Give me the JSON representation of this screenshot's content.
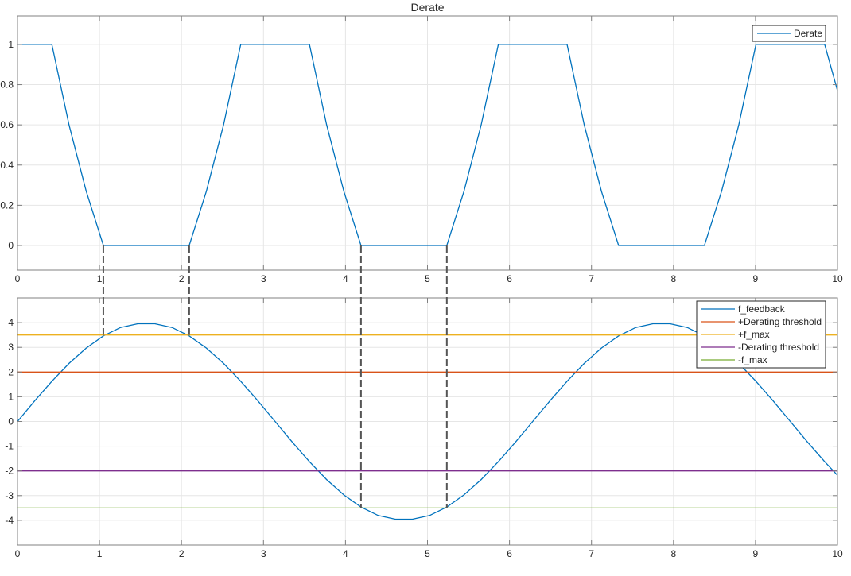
{
  "chart_data": [
    {
      "type": "line",
      "title": "Derate",
      "xlabel": "",
      "ylabel": "",
      "xlim": [
        0,
        10
      ],
      "ylim": [
        -0.1225,
        1.142
      ],
      "xticks": [
        0,
        1,
        2,
        3,
        4,
        5,
        6,
        7,
        8,
        9,
        10
      ],
      "yticks": [
        0,
        0.2,
        0.4,
        0.6,
        0.8,
        1
      ],
      "ytick_labels": [
        "0",
        "0.2",
        "0.4",
        "0.6",
        "0.8",
        "1"
      ],
      "grid": true,
      "legend_position": "top-right",
      "sample_interval": 0.20944,
      "t_end": 10,
      "series": [
        {
          "name": "Derate",
          "color": "#0072BD",
          "values": [
            1,
            1,
            1,
            0.6,
            0.27,
            0,
            0,
            0,
            0,
            0,
            0,
            0.27,
            0.6,
            1,
            1,
            1,
            1,
            1,
            0.6,
            0.27,
            0,
            0,
            0,
            0,
            0,
            0,
            0.27,
            0.6,
            1,
            1,
            1,
            1,
            1,
            0.6,
            0.27,
            0,
            0,
            0,
            0,
            0,
            0,
            0.27,
            0.6,
            1,
            1,
            1,
            1,
            1,
            0.77
          ]
        }
      ]
    },
    {
      "type": "line",
      "title": "",
      "xlabel": "",
      "ylabel": "",
      "xlim": [
        0,
        10
      ],
      "ylim": [
        -5,
        5
      ],
      "xticks": [
        0,
        1,
        2,
        3,
        4,
        5,
        6,
        7,
        8,
        9,
        10
      ],
      "yticks": [
        -4,
        -3,
        -2,
        -1,
        0,
        1,
        2,
        3,
        4
      ],
      "ytick_labels": [
        "-4",
        "-3",
        "-2",
        "-1",
        "0",
        "1",
        "2",
        "3",
        "4"
      ],
      "grid": true,
      "legend_position": "top-right",
      "sample_interval": 0.20944,
      "t_end": 10,
      "series": [
        {
          "name": "f_feedback",
          "color": "#0072BD",
          "values": [
            0,
            0.8316,
            1.6269,
            2.3511,
            2.9726,
            3.4641,
            3.8042,
            3.9563,
            3.9563,
            3.8042,
            3.4641,
            2.9726,
            2.3511,
            1.6269,
            0.8316,
            0,
            -0.8316,
            -1.6269,
            -2.3511,
            -2.9726,
            -3.4641,
            -3.8042,
            -3.9563,
            -3.9563,
            -3.8042,
            -3.4641,
            -2.9726,
            -2.3511,
            -1.6269,
            -0.8316,
            0,
            0.8316,
            1.6269,
            2.3511,
            2.9726,
            3.4641,
            3.8042,
            3.9563,
            3.9563,
            3.8042,
            3.4641,
            2.9726,
            2.3511,
            1.6269,
            0.8316,
            0,
            -0.8316,
            -1.6269,
            -2.176
          ]
        },
        {
          "name": "+Derating threshold",
          "color": "#D95319",
          "constant": 2
        },
        {
          "name": "+f_max",
          "color": "#EDB120",
          "constant": 3.5
        },
        {
          "name": "-Derating threshold",
          "color": "#7E2F8E",
          "constant": -2
        },
        {
          "name": "-f_max",
          "color": "#77AC30",
          "constant": -3.5
        }
      ]
    }
  ],
  "annotations": {
    "dashed_lines": [
      {
        "x": 1.047,
        "to_f": 3.5
      },
      {
        "x": 2.094,
        "to_f": 3.5
      },
      {
        "x": 4.189,
        "to_f": -3.5
      },
      {
        "x": 5.236,
        "to_f": -3.5
      }
    ],
    "color": "#555555"
  }
}
